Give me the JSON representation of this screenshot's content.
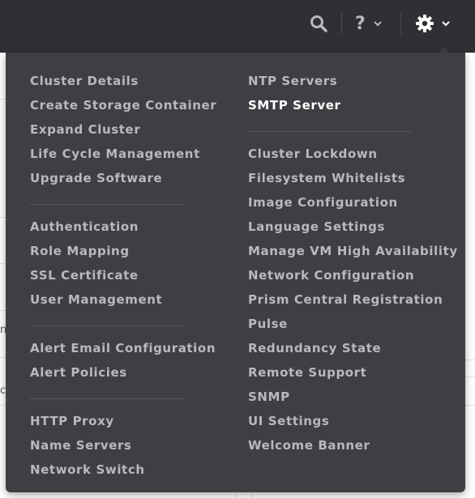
{
  "header": {
    "search_icon": "search-icon",
    "help_icon": "help-icon",
    "settings_icon": "gear-icon",
    "help_label": "?"
  },
  "background": {
    "left_fragment_1": "n",
    "left_fragment_2": "cy"
  },
  "settings_menu": {
    "left_groups": [
      [
        "Cluster Details",
        "Create Storage Container",
        "Expand Cluster",
        "Life Cycle Management",
        "Upgrade Software"
      ],
      [
        "Authentication",
        "Role Mapping",
        "SSL Certificate",
        "User Management"
      ],
      [
        "Alert Email Configuration",
        "Alert Policies"
      ],
      [
        "HTTP Proxy",
        "Name Servers",
        "Network Switch"
      ]
    ],
    "right_groups": [
      [
        "NTP Servers",
        "SMTP Server"
      ],
      [
        "Cluster Lockdown",
        "Filesystem Whitelists",
        "Image Configuration",
        "Language Settings",
        "Manage VM High Availability",
        "Network Configuration",
        "Prism Central Registration",
        "Pulse",
        "Redundancy State",
        "Remote Support",
        "SNMP",
        "UI Settings",
        "Welcome Banner"
      ]
    ],
    "active_item": "SMTP Server",
    "colors": {
      "panel_bg": "#3e3f42",
      "item_text": "#b8b9bd",
      "active_text": "#ffffff",
      "header_bg": "#2f3033"
    }
  }
}
